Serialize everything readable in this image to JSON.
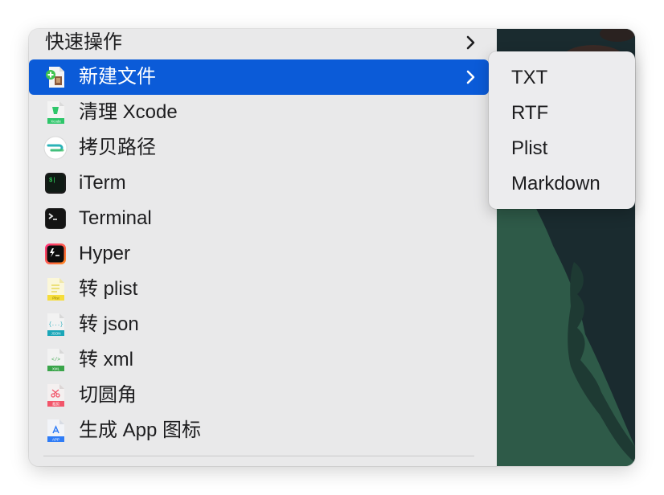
{
  "menu": {
    "items": [
      {
        "label": "快速操作",
        "icon": "none",
        "submenu": true
      },
      {
        "label": "新建文件",
        "icon": "new-file-icon",
        "submenu": true,
        "highlighted": true
      },
      {
        "label": "清理 Xcode",
        "icon": "xcode-clean-icon"
      },
      {
        "label": "拷贝路径",
        "icon": "copy-path-icon"
      },
      {
        "label": "iTerm",
        "icon": "iterm-icon"
      },
      {
        "label": "Terminal",
        "icon": "terminal-icon"
      },
      {
        "label": "Hyper",
        "icon": "hyper-icon"
      },
      {
        "label": "转 plist",
        "icon": "plist-file-icon"
      },
      {
        "label": "转 json",
        "icon": "json-file-icon"
      },
      {
        "label": "转 xml",
        "icon": "xml-file-icon"
      },
      {
        "label": "切圆角",
        "icon": "round-corner-file-icon"
      },
      {
        "label": "生成 App 图标",
        "icon": "app-icon-file-icon"
      }
    ]
  },
  "submenu": {
    "items": [
      {
        "label": "TXT"
      },
      {
        "label": "RTF"
      },
      {
        "label": "Plist"
      },
      {
        "label": "Markdown"
      }
    ]
  },
  "icon_labels": {
    "xcode": "Xcode",
    "plist": "Plist",
    "json": "JSON",
    "json_glyph": "{...}",
    "xml": "XML",
    "xml_glyph": "</>",
    "round": "裁剪",
    "app": "APP"
  },
  "colors": {
    "highlight": "#0b5bd8",
    "menu_bg": "#e9e9ea",
    "wallpaper": "#2f5a48"
  }
}
